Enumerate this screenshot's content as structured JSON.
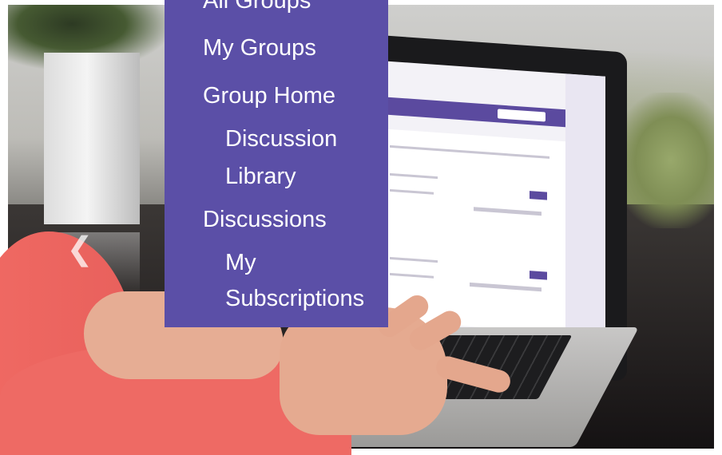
{
  "menu": {
    "items": [
      {
        "label": "All Groups",
        "level": 0
      },
      {
        "label": "My Groups",
        "level": 0
      },
      {
        "label": "Group Home",
        "level": 0
      },
      {
        "label": "Discussion",
        "level": 1
      },
      {
        "label": "Library",
        "level": 1
      },
      {
        "label": "Discussions",
        "level": 0
      },
      {
        "label": "My",
        "level": 1
      },
      {
        "label": "Subscriptions",
        "level": 1
      }
    ]
  },
  "carousel": {
    "prev_icon": "chevron-left-icon"
  },
  "colors": {
    "menu_background": "#5b4fa7",
    "menu_text": "#ffffff"
  }
}
